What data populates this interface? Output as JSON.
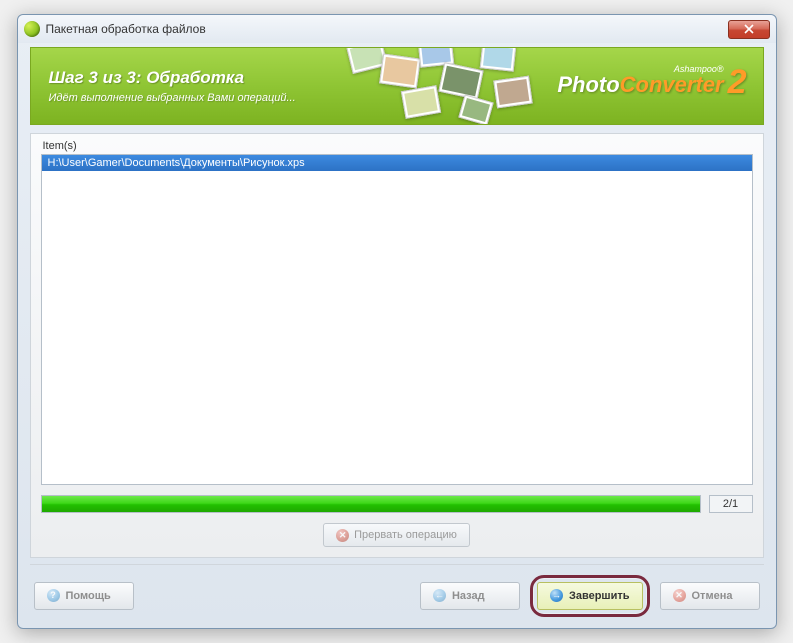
{
  "window": {
    "title": "Пакетная обработка файлов"
  },
  "header": {
    "step_title": "Шаг 3 из 3: Обработка",
    "subtitle": "Идёт выполнение выбранных Вами операций...",
    "brand_small": "Ashampoo®",
    "brand_photo": "Photo",
    "brand_converter": "Converter",
    "brand_version": "2"
  },
  "content": {
    "items_label": "Item(s)",
    "items": [
      "H:\\User\\Gamer\\Documents\\Документы\\Рисунок.xps"
    ],
    "progress_count": "2/1",
    "abort_label": "Прервать операцию"
  },
  "footer": {
    "help_label": "Помощь",
    "back_label": "Назад",
    "finish_label": "Завершить",
    "cancel_label": "Отмена"
  }
}
